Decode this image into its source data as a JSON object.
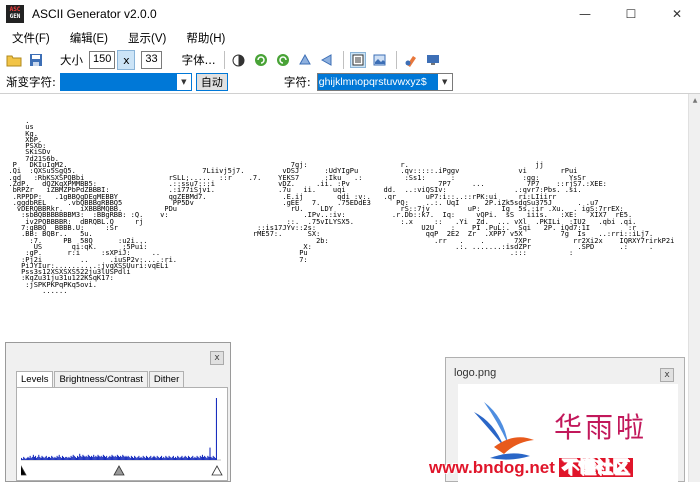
{
  "window": {
    "app_icon_text": [
      "ASC",
      "GEN"
    ],
    "title": "ASCII Generator v2.0.0",
    "minimize_glyph": "—",
    "maximize_glyph": "☐",
    "close_glyph": "✕"
  },
  "menu": [
    "文件(F)",
    "编辑(E)",
    "显示(V)",
    "帮助(H)"
  ],
  "toolbar": {
    "size_label": "大小",
    "width": "150",
    "x_label": "x",
    "height": "33",
    "font_label": "字体..."
  },
  "toolbar2": {
    "gradient_label": "渐变字符:",
    "auto_label": "自动",
    "chars_label": "字符:",
    "chars_value": "ghijklmnopqrstuvwxyz$"
  },
  "ascii_art": [
    "      .",
    "      us",
    "      Kg.",
    "      XbP.",
    "      PSXb:",
    "      SKiSDv",
    "      7d21S6b.",
    "   P   DKIuIqM2.                                                     7gj:                      r.                              jj",
    "  .Qi  :QXSu5SgQ5.                              7Liivj5j7.         vDSJ      :UdYIgPu          .qv:::::.iPggv              vi        rPui",
    "  .gd   :RbKSXSPQBbi                    rSLL;.....  ::r    .7.    YEKS7      :Iku   .:          :Ss1:      :                :gg:       YsSr",
    "  .ZdP.   dQZKqXPMMBB5:                 .::ssu7:::i               vDZ.     .ii. :Pv                     7P7     ...          7P7    ::rjS7.:XEE:",
    "   bRPZr   iZBMZPbPdZBBBI:              .:i77iSjvi.               .7u   ii.    uqi         dd.  ..:viQSIv:                .:qvr7:Pbs. .si.",
    "   .RPPDP:   .1gBBQgDEgMEBBY            qgZEBMd7.                  .E.ij        qdi :v:.   .qr       uP7:i::..::rPK:ui     ri:LIiirr",
    "   .ggdbREL     .vbQBBBgRBBQ5            PP5Dv                     .gEE   7.    .75EDdE3      PQ:    ..:. UqI      2P.iZk5sdqSu375J      . .u7",
    "    vDERQBBRkr.    iXBBBMQBB.          PDu                           rU.    LDY                rS::7jv         uP:     Ig  5s.:ir .Xu.  . igS:7rrEX:",
    "     :sbBQBBBBBBBM3:  :BBgRBB: :Q.    v:                                .IPv..:iv:           .r.Db::k7.  Iq:     vQPi.  sS   iiis.   :XE:   XIX7  rE5.",
    "      iv2PQBBBBR:  dBRQBL.Q     rj                                  ::.  .75vILYSX5.           :.x     ::   .Yi  Zd.  ... vXl  .PKILi  :IU2   .qbi .qi.",
    "     7:gBBQ  BBBB.U:     :Sr                                 ::is17JYv::2s:                         U2U    :    PI .PuL:.  Sqi   2P. iQd7:1I         :r",
    "     .BB: BQBr..   5u.                                      rME57:.      SX:                         qqP  2E2  Zr  .XPP7 v5X         7g  Is   ..:rri::iLj7.",
    "       :7.     PB  58Q      :u2i...                                        2b:                         .rr   .    .       7XPr          rr2Xi2x    IQRXY7rirkP2i",
    "        US       qi:qK.      ;5Pui:                                     X:                                  .:. .......:isdZPr           .SPD      .:     .",
    "      :gP.      r:i     :sXPiJ:     ..                                 Pu                                                .:::          :",
    "     :Pj2i         ..     .iuSP2v:....:ri.                             7:",
    "     PiJYIur:..........:jvqXSSUuri:vqELi",
    "     Pss3s12XSXSXS522ju3lUSPdli",
    "     :KqZu31ju31u122KSqK17:",
    "      :jSPKPKPqPKq5ovi.",
    "          ......"
  ],
  "levels": {
    "close_glyph": "x",
    "tabs": [
      "Levels",
      "Brightness/Contrast",
      "Dither"
    ],
    "histogram": [
      2,
      1,
      3,
      2,
      1,
      2,
      3,
      2,
      4,
      2,
      3,
      5,
      3,
      4,
      2,
      3,
      5,
      3,
      2,
      4,
      3,
      2,
      3,
      4,
      2,
      3,
      3,
      2,
      4,
      3,
      2,
      3,
      2,
      4,
      3,
      5,
      3,
      2,
      4,
      3,
      2,
      3,
      3,
      2,
      3,
      2,
      4,
      3,
      5,
      4,
      3,
      2,
      4,
      3,
      6,
      4,
      3,
      5,
      4,
      3,
      4,
      3,
      5,
      4,
      3,
      4,
      3,
      5,
      3,
      4,
      3,
      5,
      4,
      3,
      4,
      3,
      5,
      4,
      3,
      4,
      2,
      3,
      4,
      3,
      5,
      4,
      3,
      4,
      3,
      5,
      4,
      3,
      4,
      3,
      5,
      4,
      3,
      4,
      3,
      4,
      3,
      2,
      4,
      3,
      2,
      4,
      3,
      2,
      3,
      4,
      2,
      3,
      2,
      4,
      3,
      2,
      4,
      3,
      2,
      3,
      4,
      2,
      3,
      4,
      3,
      2,
      4,
      3,
      2,
      3,
      4,
      2,
      3,
      2,
      4,
      3,
      2,
      4,
      3,
      2,
      3,
      4,
      2,
      3,
      2,
      4,
      3,
      2,
      3,
      4,
      2,
      3,
      4,
      3,
      2,
      4,
      3,
      2,
      3,
      4,
      2,
      3,
      2,
      4,
      3,
      2,
      4,
      3,
      5,
      3,
      4,
      3,
      2,
      4,
      3,
      12,
      3,
      2,
      4,
      3,
      2,
      60
    ],
    "slider_min": 0,
    "slider_mid": 0.5,
    "slider_max": 1
  },
  "logo_window": {
    "title": "logo.png",
    "close_glyph": "x",
    "logo_text": "华雨啦"
  },
  "watermark": {
    "text": "www.bndog.net",
    "tail": "不懂社区"
  }
}
